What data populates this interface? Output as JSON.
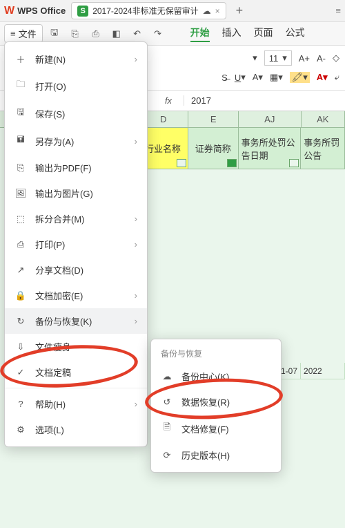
{
  "titlebar": {
    "app_name": "WPS Office",
    "tab_title": "2017-2024非标准无保留审计",
    "close": "×",
    "new": "+"
  },
  "maintb": {
    "file": "文件",
    "ribbon_tabs": [
      "开始",
      "插入",
      "页面",
      "公式"
    ]
  },
  "ribbon": {
    "font_size": "11",
    "a_plus": "A+",
    "a_minus": "A-"
  },
  "fx": {
    "label": "fx",
    "value": "2017"
  },
  "columns": {
    "d": "D",
    "e": "E",
    "aj": "AJ",
    "ak": "AK"
  },
  "headers": {
    "d": "行业名称",
    "e": "证券简称",
    "aj": "事务所处罚公告日期",
    "ak": "事务所罚公告"
  },
  "data": {
    "aj": "2-11-07",
    "ak": "2022"
  },
  "menu": {
    "new": "新建(N)",
    "open": "打开(O)",
    "save": "保存(S)",
    "saveas": "另存为(A)",
    "pdf": "输出为PDF(F)",
    "image": "输出为图片(G)",
    "split": "拆分合并(M)",
    "print": "打印(P)",
    "share": "分享文档(D)",
    "encrypt": "文档加密(E)",
    "backup": "备份与恢复(K)",
    "slim": "文件瘦身",
    "finalize": "文档定稿",
    "help": "帮助(H)",
    "options": "选项(L)"
  },
  "submenu": {
    "title": "备份与恢复",
    "center": "备份中心(K)",
    "recover": "数据恢复(R)",
    "repair": "文档修复(F)",
    "history": "历史版本(H)"
  }
}
